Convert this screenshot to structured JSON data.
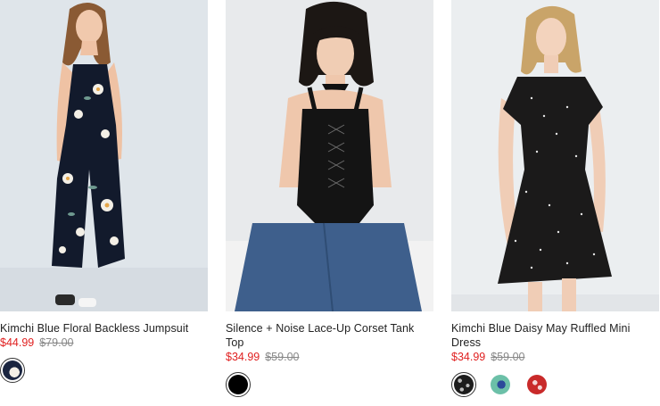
{
  "products": [
    {
      "name": "Kimchi Blue Floral Backless Jumpsuit",
      "sale_price": "$44.99",
      "original_price": "$79.00",
      "swatches": [
        "navy-floral"
      ]
    },
    {
      "name": "Silence + Noise Lace-Up Corset Tank Top",
      "sale_price": "$34.99",
      "original_price": "$59.00",
      "swatches": [
        "black"
      ]
    },
    {
      "name": "Kimchi Blue Daisy May Ruffled Mini Dress",
      "sale_price": "$34.99",
      "original_price": "$59.00",
      "swatches": [
        "black-ditsy",
        "teal-floral",
        "red-floral"
      ]
    }
  ],
  "colors": {
    "sale_price": "#e02020",
    "original_price": "#888888",
    "title": "#222222"
  }
}
